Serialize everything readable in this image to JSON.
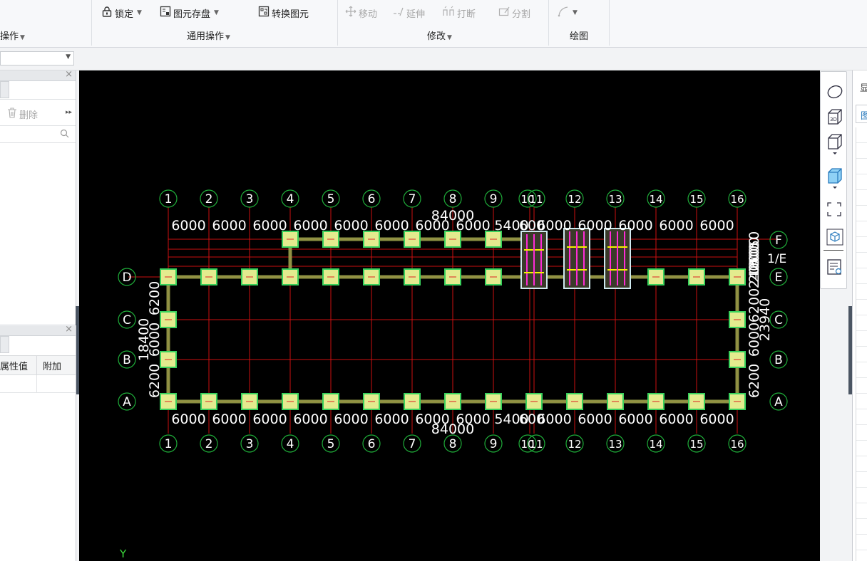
{
  "ribbon": {
    "partial_group_label": "操作",
    "lock_label": "锁定",
    "save_element_label": "图元存盘",
    "convert_label": "转换图元",
    "common_ops_label": "通用操作",
    "move_label": "移动",
    "extend_label": "延伸",
    "break_label": "打断",
    "split_label": "分割",
    "modify_label": "修改",
    "draw_label": "绘图"
  },
  "left_panel": {
    "delete_label": "删除",
    "col_value": "属性值",
    "col_extra": "附加"
  },
  "right_panel": {
    "tab_char": "显",
    "sub_char": "图"
  },
  "drawing": {
    "axes_x": [
      "1",
      "2",
      "3",
      "4",
      "5",
      "6",
      "7",
      "8",
      "9",
      "10",
      "11",
      "12",
      "13",
      "14",
      "15",
      "16"
    ],
    "axes_y": [
      "A",
      "B",
      "C",
      "D",
      "E",
      "F"
    ],
    "axis_1e": "1/E",
    "spans_x": [
      "6000",
      "6000",
      "6000",
      "6000",
      "6000",
      "6000",
      "6000",
      "6000",
      "5400",
      "600",
      "6000",
      "6000",
      "6000",
      "6000",
      "6000"
    ],
    "total_x": "84000",
    "spans_left": [
      "6200",
      "6000",
      "6200"
    ],
    "total_left": "18400",
    "spans_right_low": [
      "6200",
      "6000",
      "6200"
    ],
    "spans_right_high": [
      "2400",
      "2050",
      "1000",
      "2000",
      "4050"
    ],
    "total_right": "23940",
    "ucs_y": "Y"
  },
  "colors": {
    "canvas_bg": "#000000",
    "axis_line": "#cc1111",
    "bubble": "#1fae3a",
    "column_fill": "#e3eb8e",
    "column_border": "#39d15c",
    "beam": "#9aa04a",
    "footing_box": "#cfe9ef",
    "rebar_pink": "#ff2bd6",
    "rebar_yellow": "#f5f000",
    "text": "#ffffff"
  },
  "icons": [
    "lock-icon",
    "save-element-icon",
    "convert-element-icon",
    "move-icon",
    "extend-icon",
    "break-icon",
    "split-icon",
    "draw-arc-icon",
    "orbit-icon",
    "view-3d-icon",
    "box-view-icon",
    "solid-box-icon",
    "fit-view-icon",
    "layer-3d-icon",
    "properties-view-icon",
    "search-icon",
    "delete-icon"
  ]
}
